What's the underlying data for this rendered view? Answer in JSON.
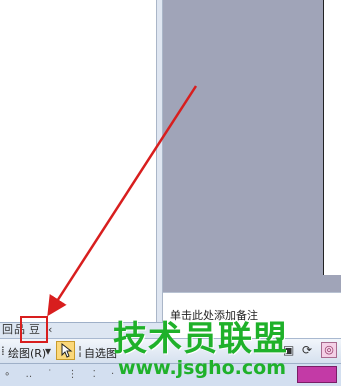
{
  "notes": {
    "placeholder": "单击此处添加备注"
  },
  "view_buttons": {
    "normal": "回",
    "sorter": "品",
    "slideshow": "豆",
    "scroll": "‹"
  },
  "draw_toolbar": {
    "draw_label": "绘图(R)",
    "draw_dropdown": "▾",
    "autoshapes_label": "自选图",
    "select_icon": "arrow-cursor-icon",
    "icons": [
      "line-icon",
      "rectangle-icon",
      "oval-icon",
      "textbox-icon",
      "picture-icon",
      "rotate-icon",
      "clipart-icon"
    ]
  },
  "watermark": {
    "title": "技术员联盟",
    "url": "www.jsgho.com"
  },
  "colors": {
    "annotation": "#d81e1e",
    "watermark": "#1fb12a",
    "workspace": "#a0a4b8"
  }
}
